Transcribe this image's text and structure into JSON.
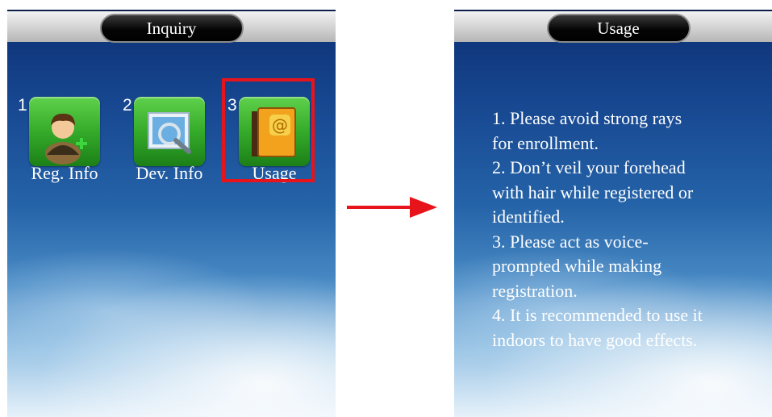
{
  "left_screen": {
    "title": "Inquiry",
    "apps": [
      {
        "number": "1",
        "label": "Reg. Info",
        "icon": "user-add-icon"
      },
      {
        "number": "2",
        "label": "Dev. Info",
        "icon": "device-search-icon"
      },
      {
        "number": "3",
        "label": "Usage",
        "icon": "address-book-icon"
      }
    ],
    "highlighted": "Usage"
  },
  "right_screen": {
    "title": "Usage",
    "lines": [
      "1.  Please avoid strong rays",
      "for enrollment.",
      "2.  Don’t veil your forehead",
      "with hair while registered or",
      "identified.",
      "3.  Please act as voice-",
      "prompted while making",
      "registration.",
      "4. It is recommended to use it",
      "indoors to have good effects."
    ]
  },
  "colors": {
    "highlight": "#e8141b",
    "arrow": "#e8141b",
    "icon_green": "#35ab2a"
  }
}
